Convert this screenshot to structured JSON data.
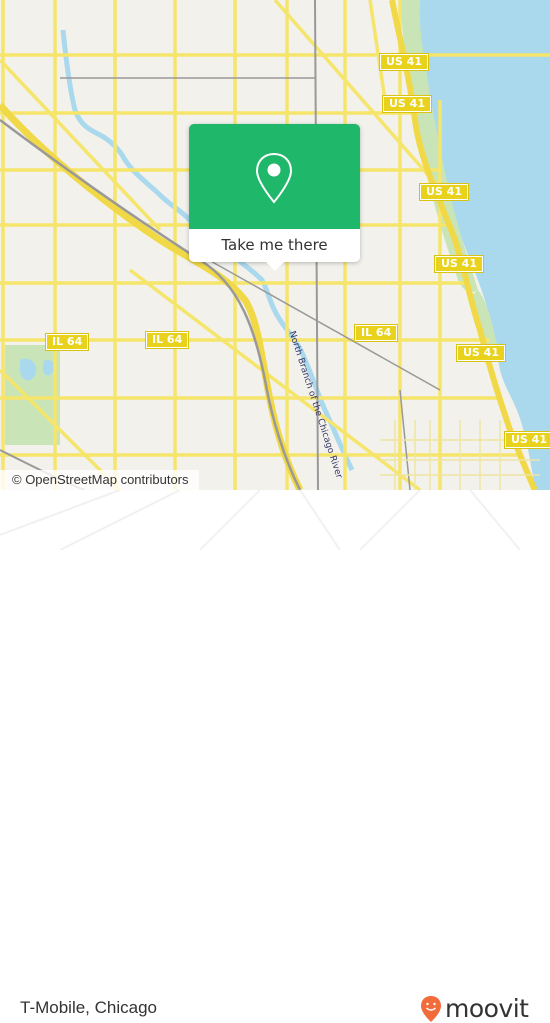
{
  "map": {
    "attribution": "© OpenStreetMap contributors",
    "shields": [
      {
        "label": "US 41",
        "type": "us"
      },
      {
        "label": "US 41",
        "type": "us"
      },
      {
        "label": "US 41",
        "type": "us"
      },
      {
        "label": "US 41",
        "type": "us"
      },
      {
        "label": "US 41",
        "type": "us"
      },
      {
        "label": "US 41",
        "type": "us"
      },
      {
        "label": "IL 64",
        "type": "state"
      },
      {
        "label": "IL 64",
        "type": "state"
      },
      {
        "label": "IL 64",
        "type": "state"
      }
    ],
    "river_labels": [
      "North Branch of the Chicago River",
      "Chicago River"
    ],
    "colors": {
      "land": "#f2f1ec",
      "water": "#aad9ee",
      "park": "#c9e5b8",
      "road": "#f5e56b",
      "rail": "#999999"
    }
  },
  "popup": {
    "action_label": "Take me there",
    "icon": "map-pin-icon",
    "color": "#1fb76a"
  },
  "footer": {
    "place_name": "T-Mobile, Chicago",
    "brand": "moovit",
    "brand_color": "#f26b3a"
  }
}
